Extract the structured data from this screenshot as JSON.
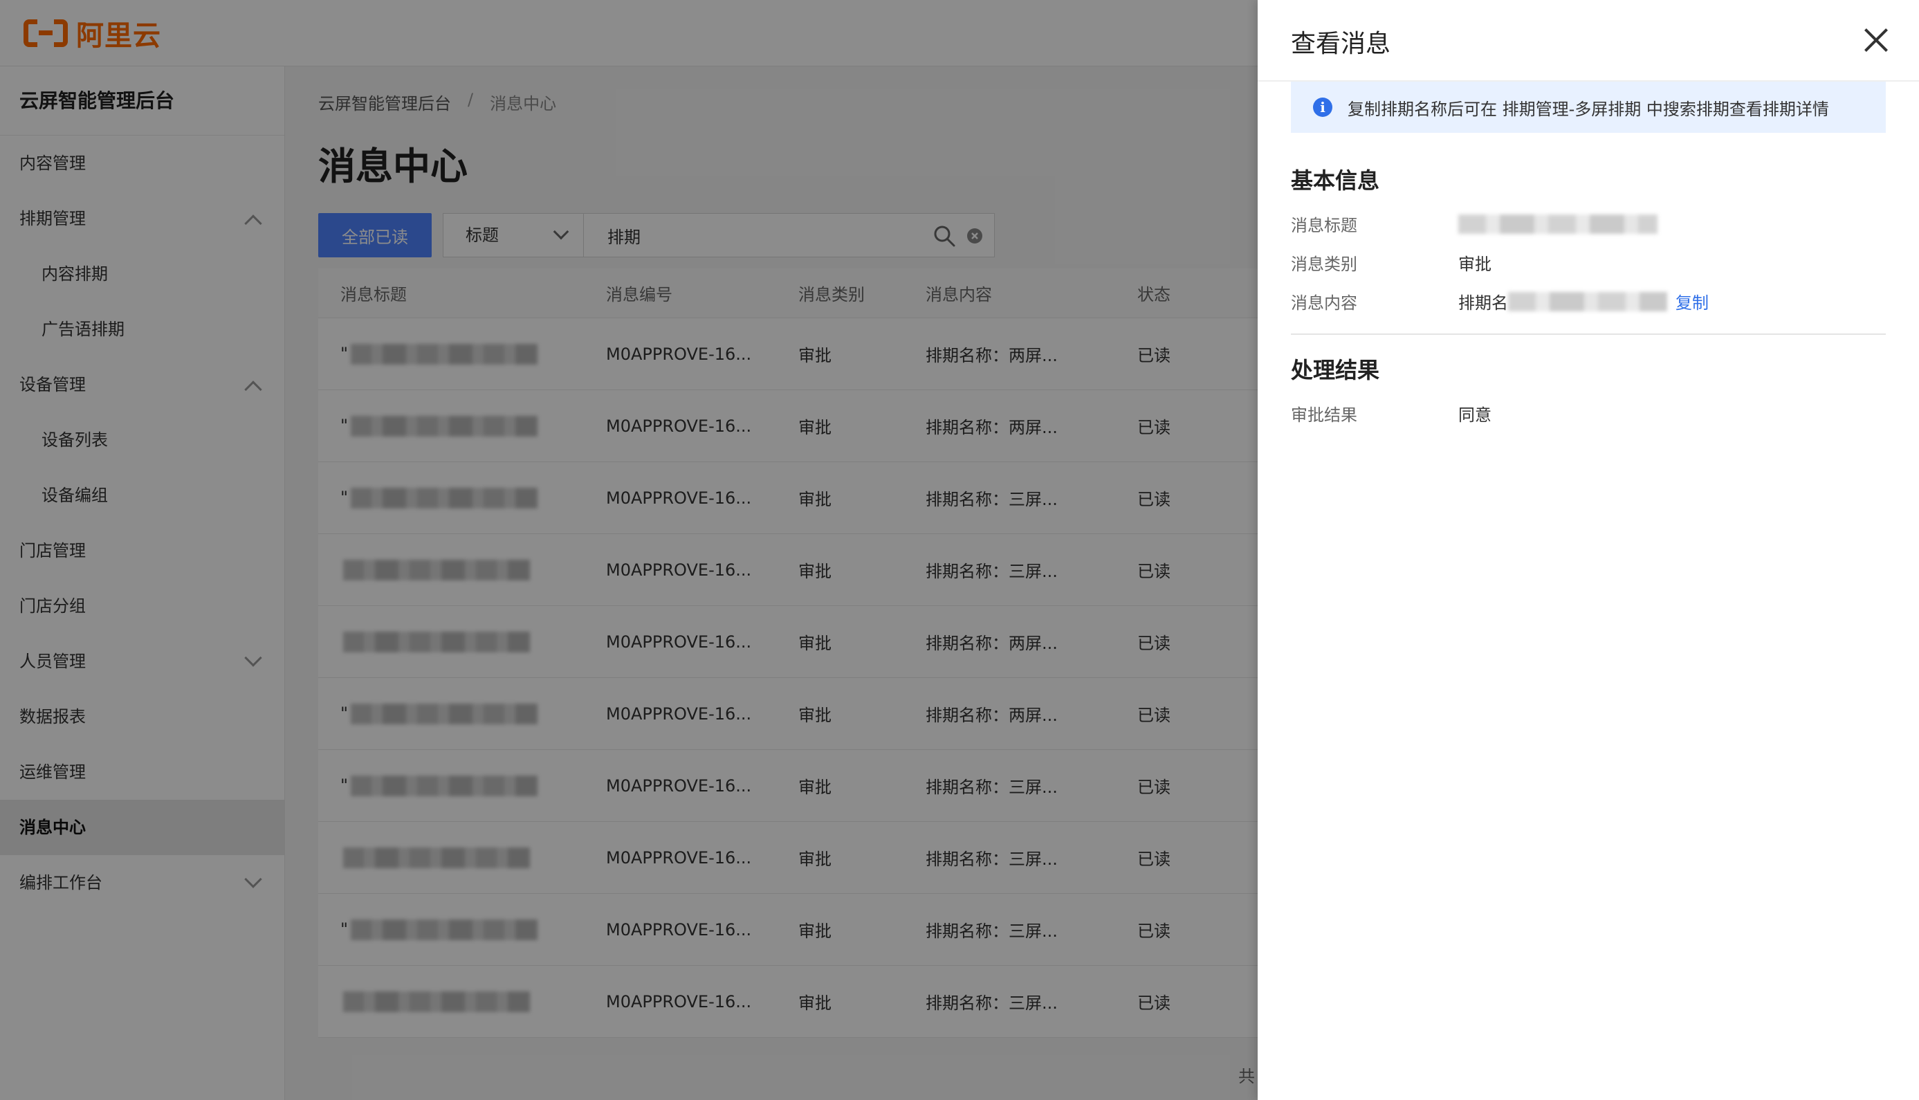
{
  "brand": {
    "logo_text": "阿里云"
  },
  "sidebar": {
    "title": "云屏智能管理后台",
    "items": [
      {
        "label": "内容管理"
      },
      {
        "label": "排期管理"
      },
      {
        "label": "内容排期"
      },
      {
        "label": "广告语排期"
      },
      {
        "label": "设备管理"
      },
      {
        "label": "设备列表"
      },
      {
        "label": "设备编组"
      },
      {
        "label": "门店管理"
      },
      {
        "label": "门店分组"
      },
      {
        "label": "人员管理"
      },
      {
        "label": "数据报表"
      },
      {
        "label": "运维管理"
      },
      {
        "label": "消息中心"
      },
      {
        "label": "编排工作台"
      }
    ]
  },
  "breadcrumb": {
    "root": "云屏智能管理后台",
    "separator": "/",
    "current": "消息中心"
  },
  "page": {
    "title": "消息中心"
  },
  "toolbar": {
    "mark_all_read": "全部已读",
    "filter_select_value": "标题",
    "search_value": "排期"
  },
  "table": {
    "headers": [
      "消息标题",
      "消息编号",
      "消息类别",
      "消息内容",
      "状态"
    ],
    "rows": [
      {
        "title_prefix": "\"",
        "id": "M0APPROVE-16...",
        "category": "审批",
        "content": "排期名称：两屏...",
        "status": "已读"
      },
      {
        "title_prefix": "\"",
        "id": "M0APPROVE-16...",
        "category": "审批",
        "content": "排期名称：两屏...",
        "status": "已读"
      },
      {
        "title_prefix": "\"",
        "id": "M0APPROVE-16...",
        "category": "审批",
        "content": "排期名称：三屏...",
        "status": "已读"
      },
      {
        "title_prefix": "",
        "id": "M0APPROVE-16...",
        "category": "审批",
        "content": "排期名称：三屏...",
        "status": "已读"
      },
      {
        "title_prefix": "",
        "id": "M0APPROVE-16...",
        "category": "审批",
        "content": "排期名称：两屏...",
        "status": "已读"
      },
      {
        "title_prefix": "\"",
        "id": "M0APPROVE-16...",
        "category": "审批",
        "content": "排期名称：两屏...",
        "status": "已读"
      },
      {
        "title_prefix": "\"",
        "id": "M0APPROVE-16...",
        "category": "审批",
        "content": "排期名称：三屏...",
        "status": "已读"
      },
      {
        "title_prefix": "",
        "id": "M0APPROVE-16...",
        "category": "审批",
        "content": "排期名称：三屏...",
        "status": "已读"
      },
      {
        "title_prefix": "\"",
        "id": "M0APPROVE-16...",
        "category": "审批",
        "content": "排期名称：三屏...",
        "status": "已读"
      },
      {
        "title_prefix": "",
        "id": "M0APPROVE-16...",
        "category": "审批",
        "content": "排期名称：三屏...",
        "status": "已读"
      }
    ],
    "footer_text": "共"
  },
  "drawer": {
    "title": "查看消息",
    "notice": "复制排期名称后可在 排期管理-多屏排期 中搜索排期查看排期详情",
    "basic_info_title": "基本信息",
    "fields": {
      "title_label": "消息标题",
      "category_label": "消息类别",
      "category_value": "审批",
      "content_label": "消息内容",
      "content_prefix": "排期名",
      "copy_link": "复制"
    },
    "result_title": "处理结果",
    "result_label": "审批结果",
    "result_value": "同意"
  }
}
